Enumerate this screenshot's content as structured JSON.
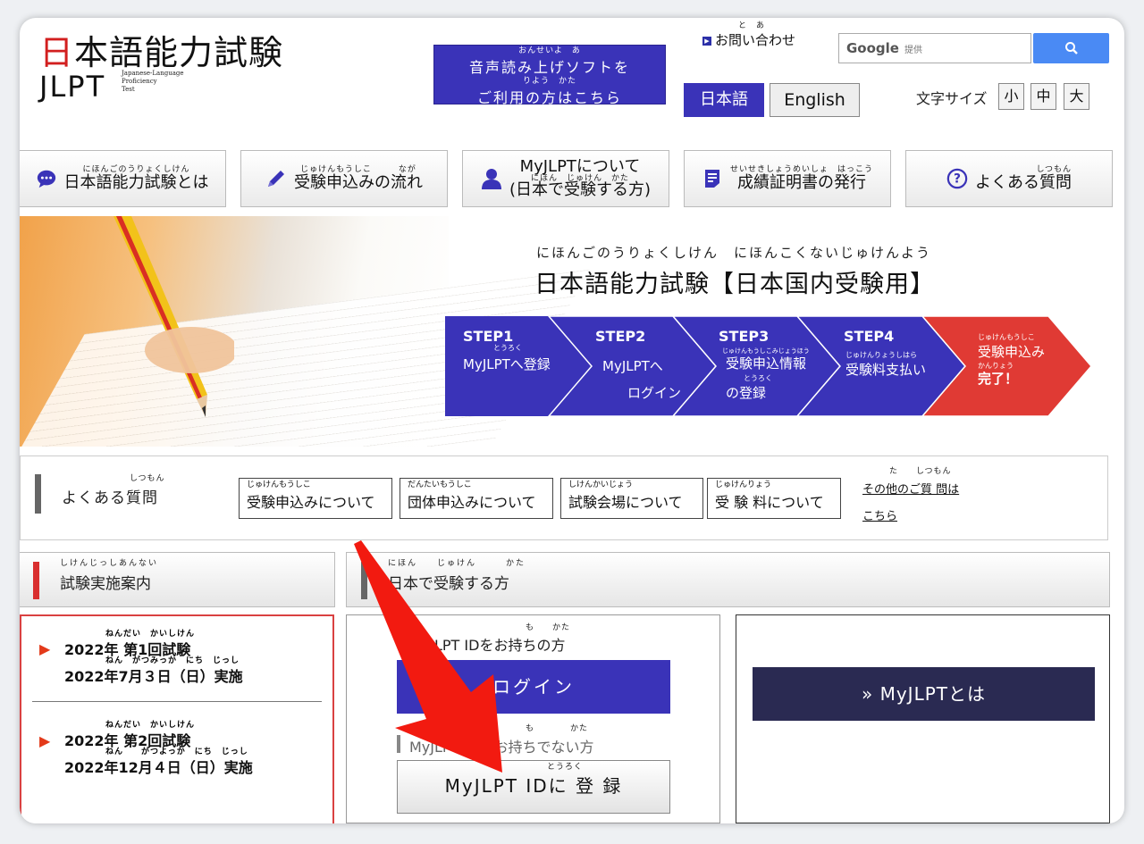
{
  "header": {
    "logo_kanji_red": "日",
    "logo_kanji_rest": "本語能力試験",
    "logo_jlpt": "JLPT",
    "logo_sub": [
      "Japanese-Language",
      "Proficiency",
      "Test"
    ],
    "speech_ruby_1": "おんせいよ　あ",
    "speech_line_1": "音声読み上げソフトを",
    "speech_ruby_2": "りよう　かた",
    "speech_line_2": "ご利用の方はこちら",
    "contact_ruby": "と　あ",
    "contact_label": "お問い合わせ",
    "search_brand": "Google",
    "search_tail": "提供",
    "lang_ja": "日本語",
    "lang_en": "English",
    "fontsize_label": "文字サイズ",
    "fontsize_small": "小",
    "fontsize_mid": "中",
    "fontsize_large": "大"
  },
  "nav": [
    {
      "ruby": "にほんごのうりょくしけん",
      "label": "日本語能力試験とは",
      "icon": "speech-bubble-icon"
    },
    {
      "ruby": "じゅけんもうしこ　　　なが",
      "label": "受験申込みの流れ",
      "icon": "pencil-icon"
    },
    {
      "ruby": "",
      "label_1": "MyJLPTについて",
      "label_2": "(日本で受験する方)",
      "ruby_2": "にほん　じゅけん　かた",
      "icon": "person-icon"
    },
    {
      "ruby": "せいせきしょうめいしょ　はっこう",
      "label": "成績証明書の発行",
      "icon": "document-icon"
    },
    {
      "ruby": "しつもん",
      "label": "よくある質問",
      "icon": "question-icon"
    }
  ],
  "hero": {
    "ruby": "にほんごのうりょくしけん　にほんこくないじゅけんよう",
    "title": "日本語能力試験【日本国内受験用】",
    "steps": [
      {
        "num": "STEP1",
        "ruby": "とうろく",
        "line1": "MyJLPTへ登録",
        "line2": ""
      },
      {
        "num": "STEP2",
        "ruby": "",
        "line1": "MyJLPTへ",
        "line2": "ログイン"
      },
      {
        "num": "STEP3",
        "ruby": "じゅけんもうしこみじょうほう",
        "line1": "受験申込情報",
        "ruby2": "とうろく",
        "line2": "の登録"
      },
      {
        "num": "STEP4",
        "ruby": "じゅけんりょうしはら",
        "line1": "受験料支払い",
        "line2": ""
      },
      {
        "num": "",
        "ruby": "じゅけんもうしこ",
        "line1": "受験申込み",
        "ruby2": "かんりょう",
        "line2": "完了！"
      }
    ]
  },
  "faq": {
    "ruby": "しつもん",
    "title": "よくある質問",
    "buttons": [
      {
        "ruby": "じゅけんもうしこ",
        "label": "受験申込みについて"
      },
      {
        "ruby": "だんたいもうしこ",
        "label": "団体申込みについて"
      },
      {
        "ruby": "しけんかいじょう",
        "label": "試験会場について"
      },
      {
        "ruby": "じゅけんりょう",
        "label": "受 験 料について"
      }
    ],
    "other_ruby": "た　　しつもん",
    "other_line1": "その他のご質 問は",
    "other_line2": "こちら"
  },
  "sections": {
    "left_ruby": "しけんじっしあんない",
    "left_title": "試験実施案内",
    "mid_ruby": "にほん　　じゅけん　　　かた",
    "mid_title": "日本で受験する方"
  },
  "exams": [
    {
      "ruby1": "ねんだい　かいしけん",
      "line1": "2022年 第1回試験",
      "ruby2": "ねん　がつみっか　にち　じっし",
      "line2": "2022年7月３日（日）実施"
    },
    {
      "ruby1": "ねんだい　かいしけん",
      "line1": "2022年 第2回試験",
      "ruby2": "ねん　　がつよっか　にち　じっし",
      "line2": "2022年12月４日（日）実施"
    }
  ],
  "myjlpt": {
    "have_ruby": "も　　かた",
    "have_label": "MyJLPT IDをお持ちの方",
    "login_label": "ログイン",
    "nothave_ruby": "も　　　　かた",
    "nothave_label": "MyJLPT IDをお持ちでない方",
    "register_ruby": "とうろく",
    "register_label": "MyJLPT IDに 登 録",
    "about_label": "» MyJLPTとは"
  },
  "colors": {
    "brand_blue": "#3a33b8",
    "step_red": "#e03a34",
    "annotation_arrow": "#f21a10",
    "navy": "#2a2a52"
  }
}
